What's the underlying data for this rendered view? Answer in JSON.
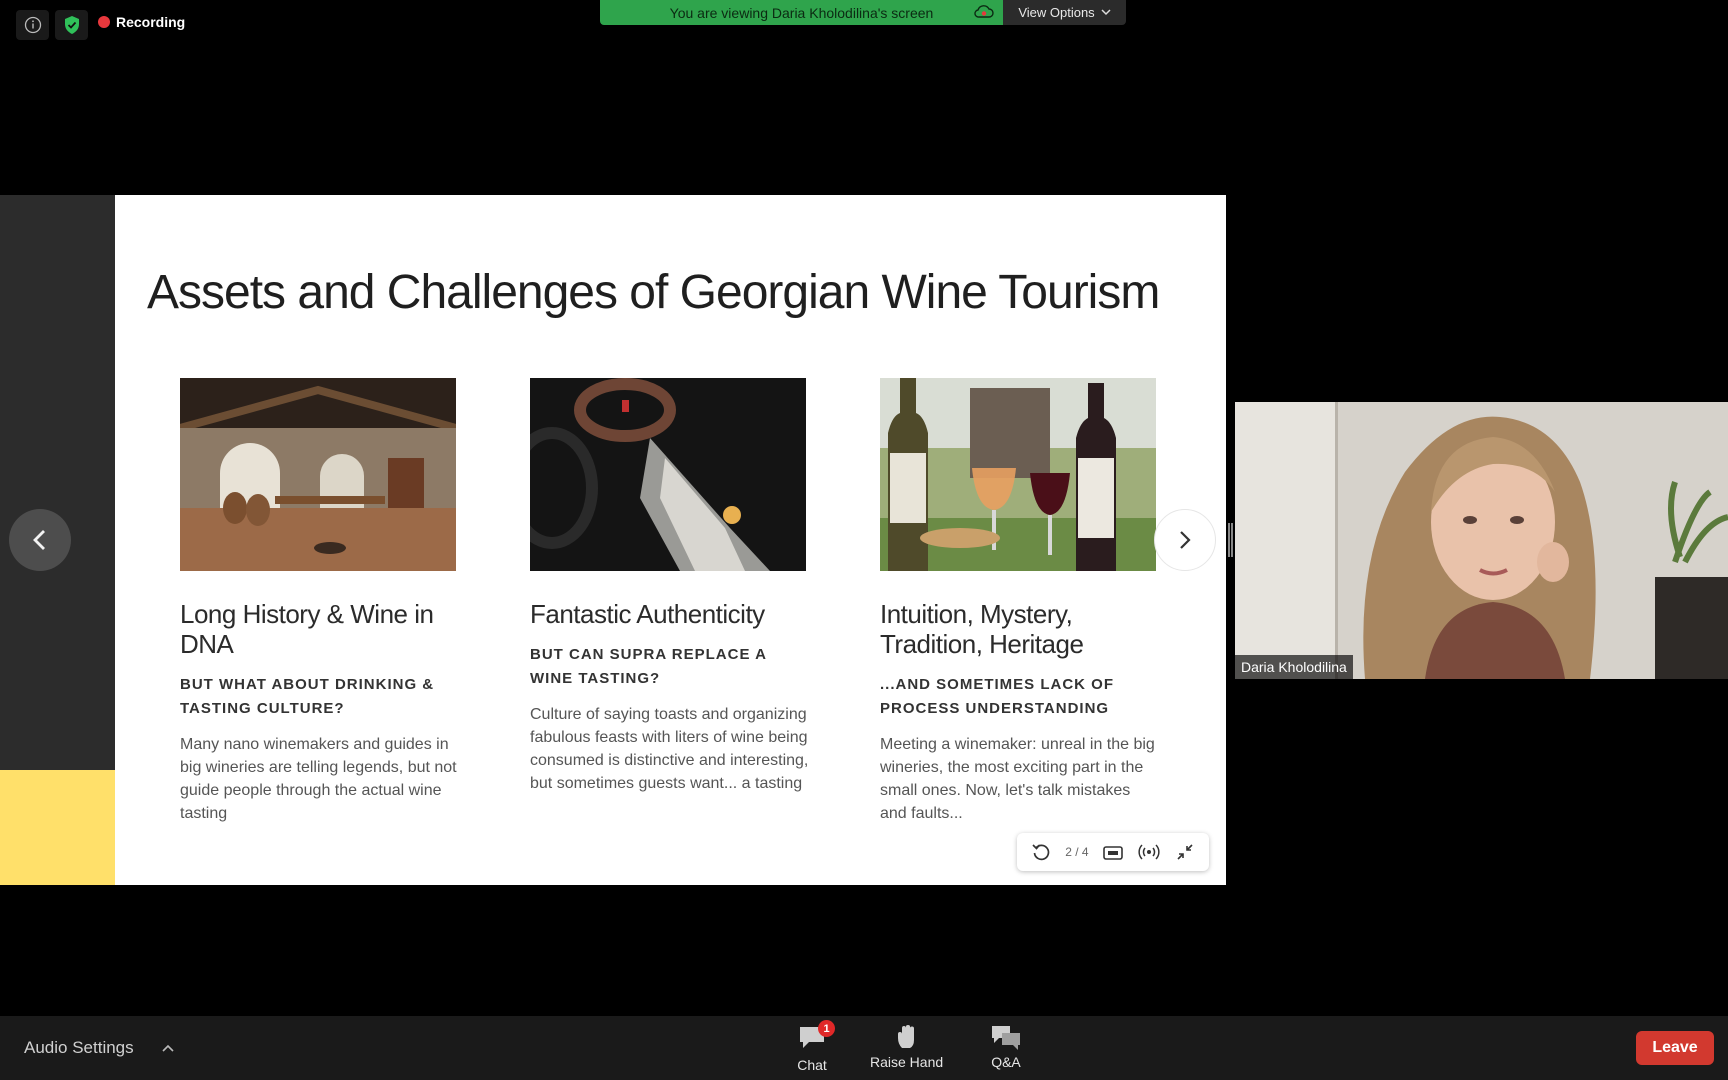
{
  "top_bar": {
    "recording_label": "Recording",
    "viewing_banner": "You are viewing Daria Kholodilina's screen",
    "view_options_label": "View Options"
  },
  "slide": {
    "title": "Assets and Challenges of Georgian Wine Tourism",
    "cards": [
      {
        "heading": "Long History & Wine in DNA",
        "subheading": "BUT WHAT ABOUT DRINKING & TASTING CULTURE?",
        "body": "Many nano winemakers and guides in big wineries are telling legends, but not guide people through the actual wine tasting"
      },
      {
        "heading": "Fantastic Authenticity",
        "subheading": "BUT CAN SUPRA REPLACE A WINE TASTING?",
        "body": "Culture of saying toasts and organizing fabulous feasts with liters of wine being consumed is distinctive and interesting, but sometimes guests want... a tasting"
      },
      {
        "heading": "Intuition, Mystery, Tradition, Heritage",
        "subheading": "...AND SOMETIMES LACK OF PROCESS UNDERSTANDING",
        "body": "Meeting a winemaker: unreal in the big wineries, the most exciting part in the small ones. Now, let's talk mistakes and faults..."
      }
    ],
    "pager": "2 / 4"
  },
  "video": {
    "participant_name": "Daria Kholodilina"
  },
  "bottom_bar": {
    "audio_settings_label": "Audio Settings",
    "chat_label": "Chat",
    "chat_badge": "1",
    "raise_hand_label": "Raise Hand",
    "qa_label": "Q&A",
    "leave_label": "Leave"
  },
  "colors": {
    "banner_green": "#2fa44c",
    "recording_red": "#e8383d",
    "slide_accent_yellow": "#ffe06a",
    "leave_red": "#d2392f"
  }
}
